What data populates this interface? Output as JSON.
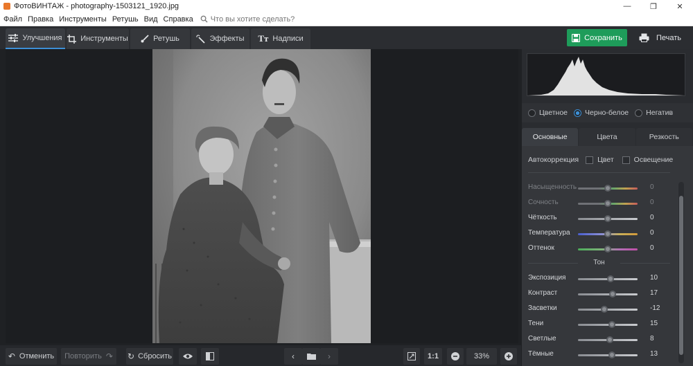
{
  "window": {
    "title": "ФотоВИНТАЖ - photography-1503121_1920.jpg",
    "controls": [
      "—",
      "❐",
      "✕"
    ]
  },
  "menu": {
    "items": [
      "Файл",
      "Правка",
      "Инструменты",
      "Ретушь",
      "Вид",
      "Справка"
    ],
    "search_placeholder": "Что вы хотите сделать?"
  },
  "toolbar": {
    "tabs": [
      {
        "label": "Улучшения",
        "icon": "sliders-icon",
        "active": true
      },
      {
        "label": "Инструменты",
        "icon": "crop-icon"
      },
      {
        "label": "Ретушь",
        "icon": "brush-icon"
      },
      {
        "label": "Эффекты",
        "icon": "magic-wand-icon"
      },
      {
        "label": "Надписи",
        "icon": "text-icon"
      }
    ],
    "save_label": "Сохранить",
    "print_label": "Печать"
  },
  "bottom": {
    "undo_label": "Отменить",
    "redo_label": "Повторить",
    "reset_label": "Сбросить",
    "ratio_label": "1:1",
    "zoom_value": "33%"
  },
  "panel": {
    "color_modes": [
      {
        "label": "Цветное",
        "selected": false
      },
      {
        "label": "Черно-белое",
        "selected": true
      },
      {
        "label": "Негатив",
        "selected": false
      }
    ],
    "subtabs": [
      "Основные",
      "Цвета",
      "Резкость"
    ],
    "autocorrection": {
      "label": "Автокоррекция",
      "color_label": "Цвет",
      "light_label": "Освещение"
    },
    "sliders_main": [
      {
        "label": "Насыщенность",
        "value": "0",
        "pos": 0.5,
        "dim": true,
        "gradient": "linear-gradient(90deg,#6f7176 0%,#6f7176 35%,#6aa76a 60%,#c2a24f 80%,#c75b5b 100%)"
      },
      {
        "label": "Сочность",
        "value": "0",
        "pos": 0.5,
        "dim": true,
        "gradient": "linear-gradient(90deg,#6f7176 0%,#6f7176 35%,#6aa76a 60%,#c2a24f 80%,#c75b5b 100%)"
      },
      {
        "label": "Чёткость",
        "value": "0",
        "pos": 0.5,
        "dim": false,
        "gradient": "linear-gradient(90deg,#8a8d92,#c9cbcf)"
      },
      {
        "label": "Температура",
        "value": "0",
        "pos": 0.5,
        "dim": false,
        "gradient": "linear-gradient(90deg,#4a5fd0 0%,#8b8fd6 40%,#c9b05a 70%,#d39a3a 100%)"
      },
      {
        "label": "Оттенок",
        "value": "0",
        "pos": 0.5,
        "dim": false,
        "gradient": "linear-gradient(90deg,#4cae5a 0%,#7fb37a 40%,#b36fb6 70%,#c04fa8 100%)"
      }
    ],
    "tone_label": "Тон",
    "sliders_tone": [
      {
        "label": "Экспозиция",
        "value": "10",
        "pos": 0.55
      },
      {
        "label": "Контраст",
        "value": "17",
        "pos": 0.585
      },
      {
        "label": "Засветки",
        "value": "-12",
        "pos": 0.44
      },
      {
        "label": "Тени",
        "value": "15",
        "pos": 0.575
      },
      {
        "label": "Светлые",
        "value": "8",
        "pos": 0.54
      },
      {
        "label": "Тёмные",
        "value": "13",
        "pos": 0.565
      }
    ]
  },
  "colors": {
    "accent": "#3c8fd6",
    "save_green": "#1e9c5a"
  }
}
